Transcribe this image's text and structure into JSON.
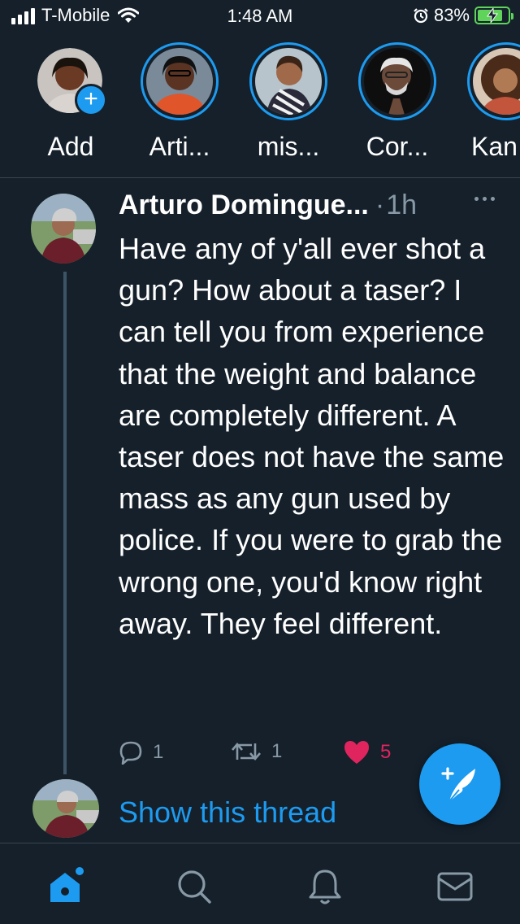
{
  "status_bar": {
    "carrier": "T-Mobile",
    "time": "1:48 AM",
    "battery_percent": "83%",
    "battery_level": 0.83,
    "icons": [
      "signal-icon",
      "wifi-icon",
      "alarm-icon",
      "battery-charging-icon"
    ]
  },
  "fleets": [
    {
      "label": "Add",
      "icon": "add-icon"
    },
    {
      "label": "Arti..."
    },
    {
      "label": "mis..."
    },
    {
      "label": "Cor..."
    },
    {
      "label": "Kan"
    }
  ],
  "tweet": {
    "author": "Arturo Domingue...",
    "separator": "·",
    "time": "1h",
    "text": "Have any of y'all ever shot a gun? How about a taser? I can tell you from experience that the weight and balance are completely different. A taser does not have the same mass as any gun used by police. If you were to grab the wrong one, you'd know right away. They feel different.",
    "replies": "1",
    "retweets": "1",
    "likes": "5",
    "show_thread": "Show this thread"
  },
  "colors": {
    "background": "#15202b",
    "accent": "#1d9bf0",
    "muted": "#8899a6",
    "like": "#e0245e",
    "battery": "#5fd35a"
  },
  "tabs": [
    {
      "name": "home",
      "icon": "home-icon",
      "active": true
    },
    {
      "name": "search",
      "icon": "search-icon"
    },
    {
      "name": "notifications",
      "icon": "bell-icon"
    },
    {
      "name": "messages",
      "icon": "mail-icon"
    }
  ],
  "compose_icon": "compose-tweet-icon"
}
